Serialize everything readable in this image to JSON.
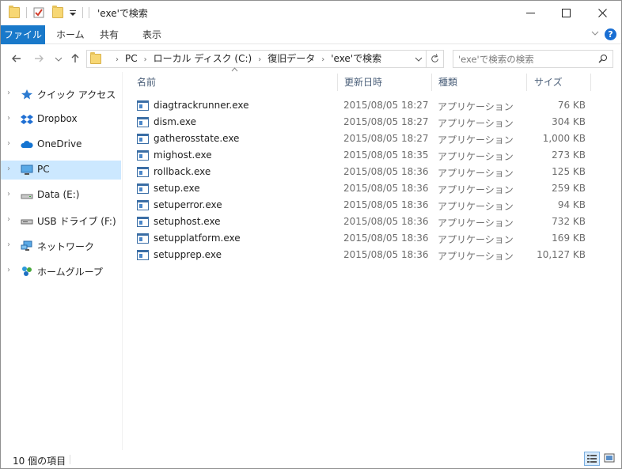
{
  "window": {
    "title": "'exe'で検索",
    "minimize_label": "—",
    "maximize_label": "☐",
    "close_label": "✕"
  },
  "ribbon": {
    "tabs": [
      "ファイル",
      "ホーム",
      "共有",
      "表示"
    ],
    "help_label": "?",
    "collapse_label": "⌄"
  },
  "address": {
    "crumbs": [
      "PC",
      "ローカル ディスク (C:)",
      "復旧データ",
      "'exe'で検索"
    ],
    "search_placeholder": "'exe'で検索の検索"
  },
  "nav": {
    "items": [
      {
        "label": "クイック アクセス",
        "icon": "star-icon",
        "selected": false
      },
      {
        "label": "Dropbox",
        "icon": "dropbox-icon",
        "selected": false
      },
      {
        "label": "OneDrive",
        "icon": "cloud-icon",
        "selected": false
      },
      {
        "label": "PC",
        "icon": "monitor-icon",
        "selected": true
      },
      {
        "label": "Data (E:)",
        "icon": "drive-icon",
        "selected": false
      },
      {
        "label": "USB ドライブ (F:)",
        "icon": "usb-drive-icon",
        "selected": false
      },
      {
        "label": "ネットワーク",
        "icon": "network-icon",
        "selected": false
      },
      {
        "label": "ホームグループ",
        "icon": "homegroup-icon",
        "selected": false
      }
    ]
  },
  "columns": {
    "name": "名前",
    "date": "更新日時",
    "type": "種類",
    "size": "サイズ"
  },
  "files": [
    {
      "name": "diagtrackrunner.exe",
      "date": "2015/08/05 18:27",
      "type": "アプリケーション",
      "size": "76 KB"
    },
    {
      "name": "dism.exe",
      "date": "2015/08/05 18:27",
      "type": "アプリケーション",
      "size": "304 KB"
    },
    {
      "name": "gatherosstate.exe",
      "date": "2015/08/05 18:27",
      "type": "アプリケーション",
      "size": "1,000 KB"
    },
    {
      "name": "mighost.exe",
      "date": "2015/08/05 18:35",
      "type": "アプリケーション",
      "size": "273 KB"
    },
    {
      "name": "rollback.exe",
      "date": "2015/08/05 18:36",
      "type": "アプリケーション",
      "size": "125 KB"
    },
    {
      "name": "setup.exe",
      "date": "2015/08/05 18:36",
      "type": "アプリケーション",
      "size": "259 KB"
    },
    {
      "name": "setuperror.exe",
      "date": "2015/08/05 18:36",
      "type": "アプリケーション",
      "size": "94 KB"
    },
    {
      "name": "setuphost.exe",
      "date": "2015/08/05 18:36",
      "type": "アプリケーション",
      "size": "732 KB"
    },
    {
      "name": "setupplatform.exe",
      "date": "2015/08/05 18:36",
      "type": "アプリケーション",
      "size": "169 KB"
    },
    {
      "name": "setupprep.exe",
      "date": "2015/08/05 18:36",
      "type": "アプリケーション",
      "size": "10,127 KB"
    }
  ],
  "status": {
    "item_count": "10 個の項目"
  },
  "colors": {
    "accent": "#1979ca",
    "selected": "#cce8ff"
  }
}
